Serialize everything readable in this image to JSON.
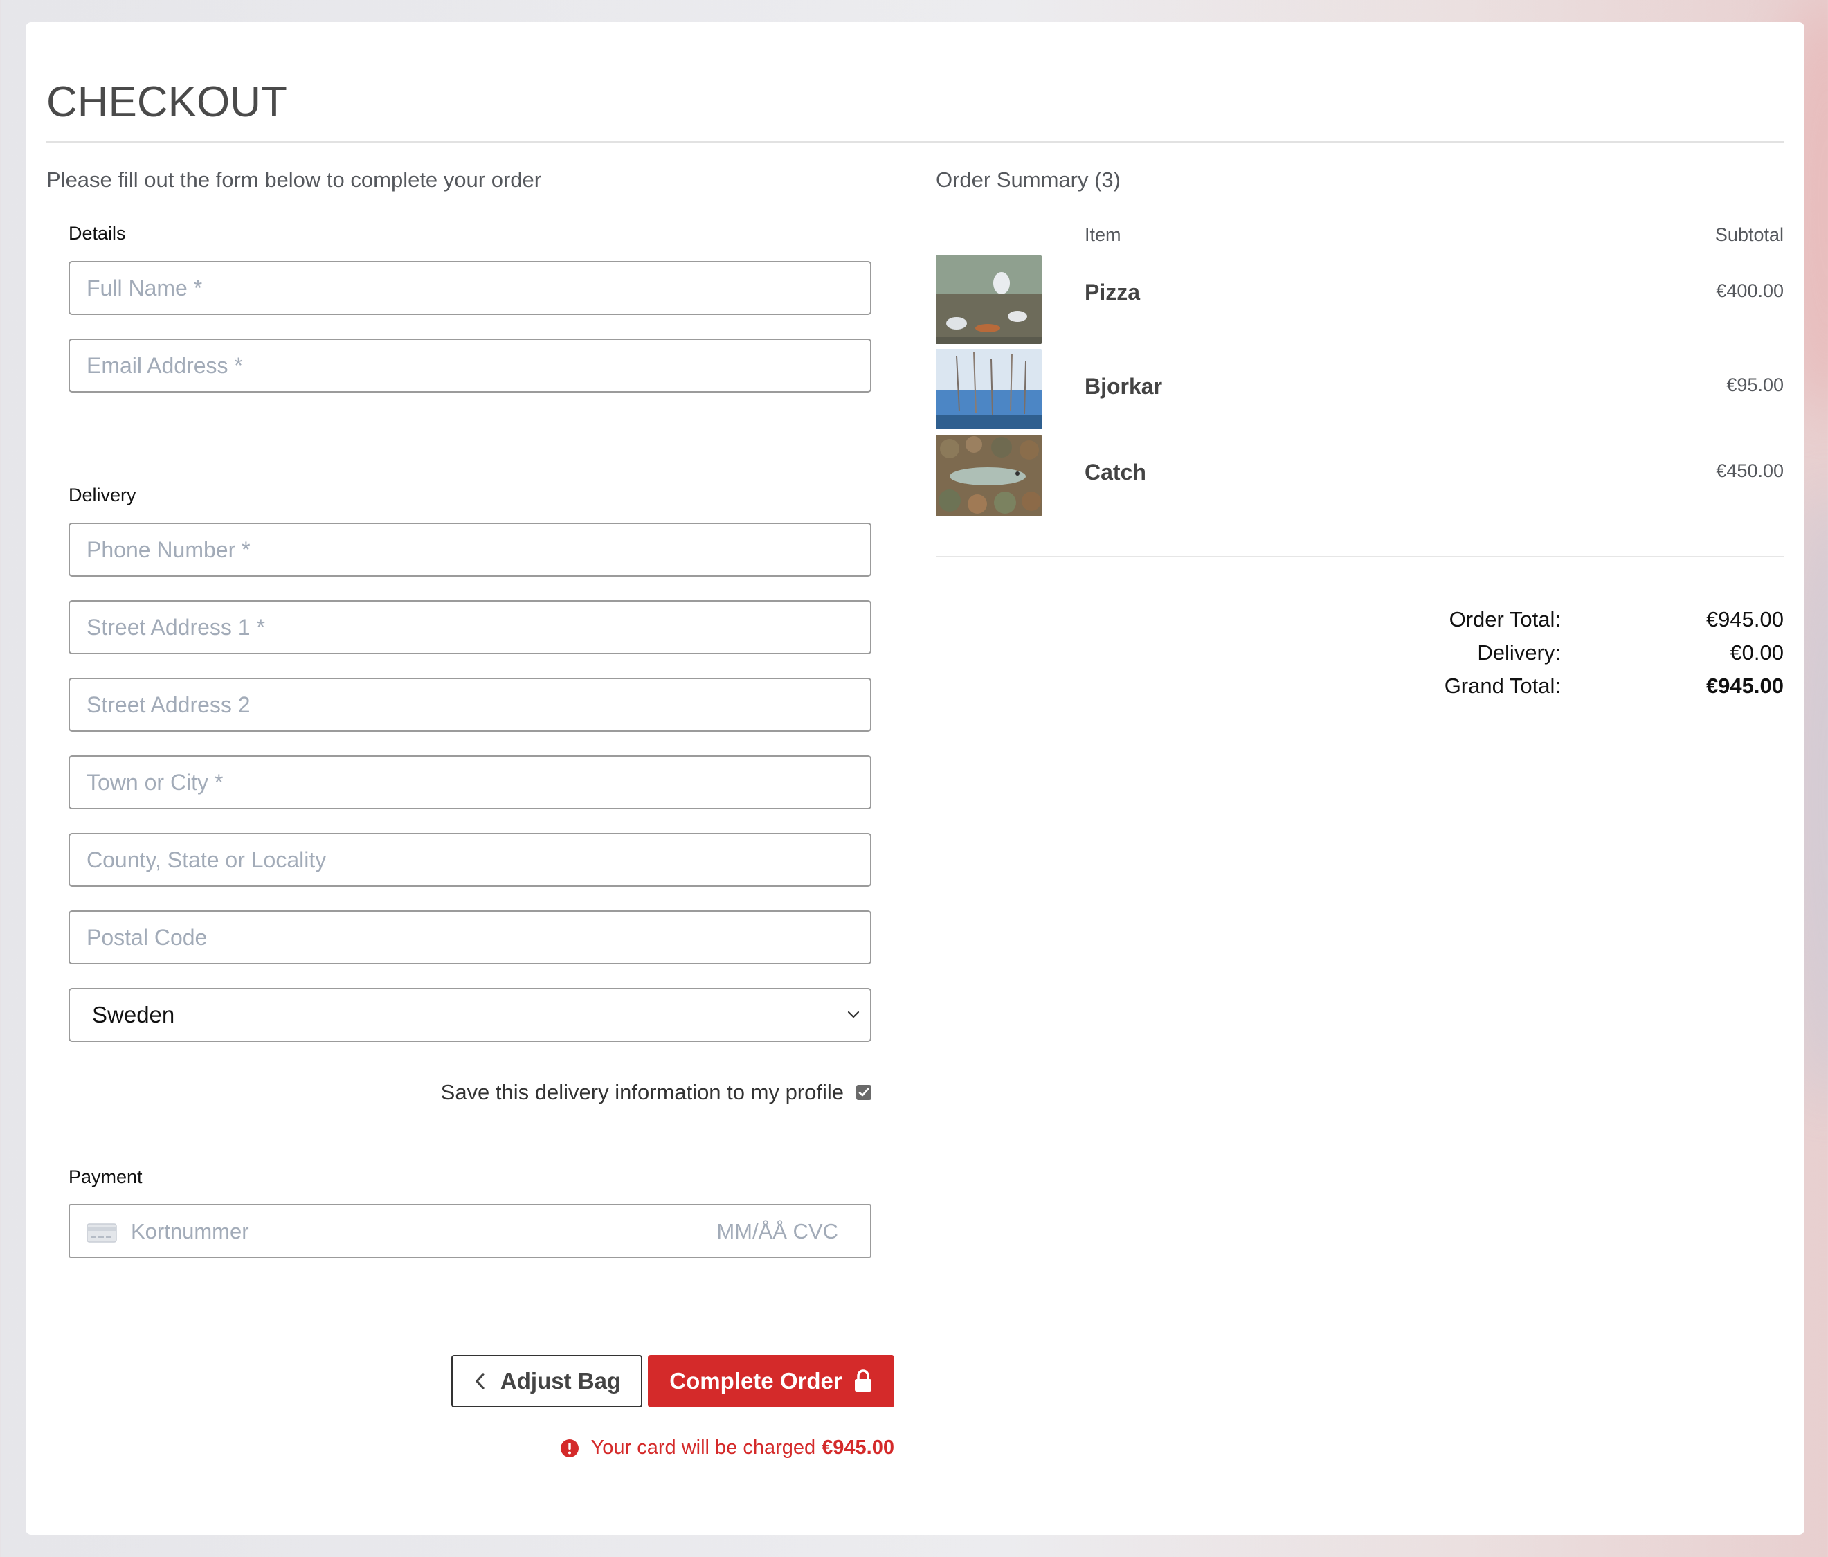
{
  "page": {
    "title": "CHECKOUT",
    "intro": "Please fill out the form below to complete your order"
  },
  "form": {
    "details_label": "Details",
    "full_name_placeholder": "Full Name *",
    "email_placeholder": "Email Address *",
    "delivery_label": "Delivery",
    "phone_placeholder": "Phone Number *",
    "street1_placeholder": "Street Address 1 *",
    "street2_placeholder": "Street Address 2",
    "town_placeholder": "Town or City *",
    "county_placeholder": "County, State or Locality",
    "postcode_placeholder": "Postal Code",
    "country_value": "Sweden",
    "save_info_label": "Save this delivery information to my profile",
    "save_info_checked": true,
    "payment_label": "Payment",
    "card_number_placeholder": "Kortnummer",
    "card_expiry_cvc_placeholder": "MM/ÅÅ CVC"
  },
  "actions": {
    "adjust_bag_label": "Adjust Bag",
    "complete_order_label": "Complete Order",
    "charge_note_text": "Your card will be charged",
    "charge_note_amount": "€945.00"
  },
  "summary": {
    "title": "Order Summary (3)",
    "col_item": "Item",
    "col_subtotal": "Subtotal",
    "items": [
      {
        "name": "Pizza",
        "subtotal": "€400.00"
      },
      {
        "name": "Bjorkar",
        "subtotal": "€95.00"
      },
      {
        "name": "Catch",
        "subtotal": "€450.00"
      }
    ],
    "order_total_label": "Order Total:",
    "order_total_value": "€945.00",
    "delivery_label": "Delivery:",
    "delivery_value": "€0.00",
    "grand_total_label": "Grand Total:",
    "grand_total_value": "€945.00"
  },
  "colors": {
    "accent": "#d42a2a",
    "text": "#444444",
    "border": "#9b9b9b"
  }
}
